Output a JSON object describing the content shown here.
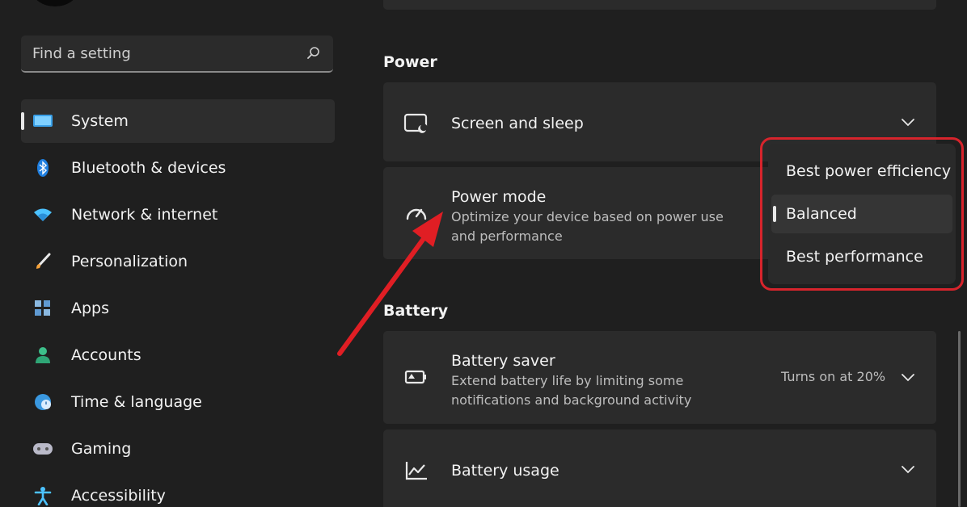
{
  "search": {
    "placeholder": "Find a setting"
  },
  "sidebar": {
    "items": [
      {
        "label": "System",
        "icon": "monitor-icon",
        "selected": true
      },
      {
        "label": "Bluetooth & devices",
        "icon": "bluetooth-icon"
      },
      {
        "label": "Network & internet",
        "icon": "wifi-icon"
      },
      {
        "label": "Personalization",
        "icon": "brush-icon"
      },
      {
        "label": "Apps",
        "icon": "apps-icon"
      },
      {
        "label": "Accounts",
        "icon": "person-icon"
      },
      {
        "label": "Time & language",
        "icon": "globe-clock-icon"
      },
      {
        "label": "Gaming",
        "icon": "gamepad-icon"
      },
      {
        "label": "Accessibility",
        "icon": "accessibility-icon"
      }
    ]
  },
  "main": {
    "power_title": "Power",
    "screen_sleep": {
      "title": "Screen and sleep"
    },
    "power_mode": {
      "title": "Power mode",
      "description": "Optimize your device based on power use and performance"
    },
    "battery_title": "Battery",
    "battery_saver": {
      "title": "Battery saver",
      "description": "Extend battery life by limiting some notifications and background activity",
      "status": "Turns on at 20%"
    },
    "battery_usage": {
      "title": "Battery usage"
    }
  },
  "dropdown": {
    "options": [
      "Best power efficiency",
      "Balanced",
      "Best performance"
    ],
    "selected": "Balanced"
  },
  "colors": {
    "highlight_ring": "#d7242c",
    "arrow": "#e01e24",
    "accent_blue": "#4cc2ff"
  }
}
